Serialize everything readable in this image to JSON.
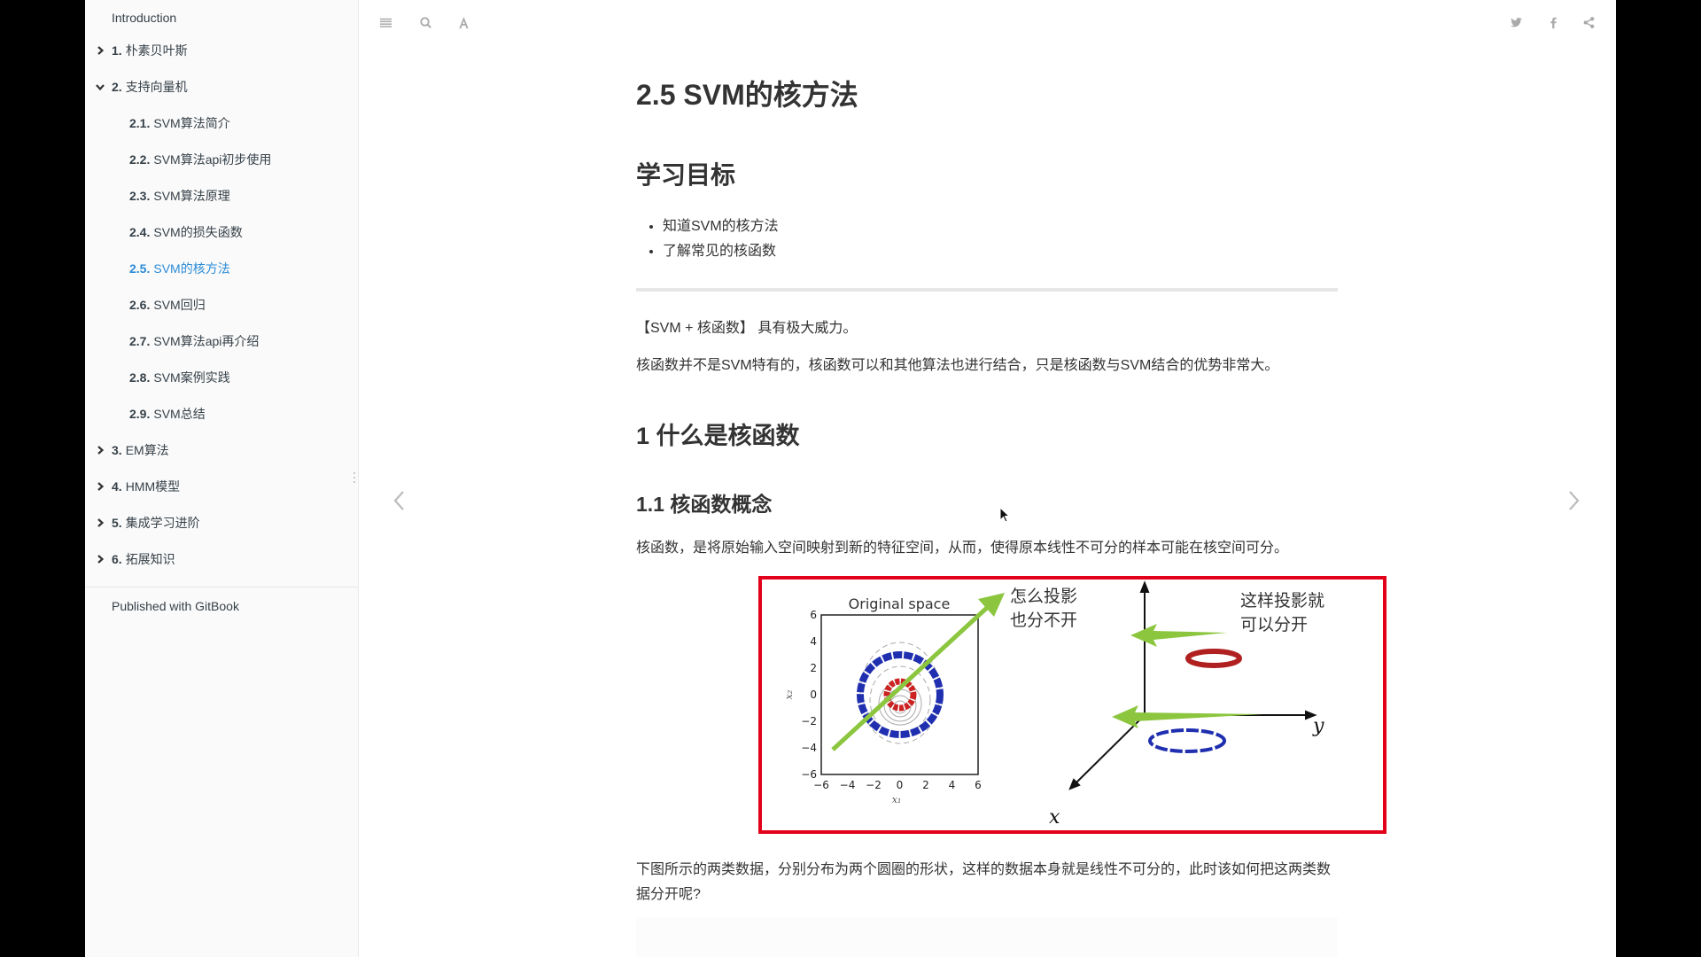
{
  "sidebar": {
    "items": [
      {
        "num": "",
        "label": "Introduction",
        "level": 0,
        "chevron": "none",
        "active": false
      },
      {
        "num": "1.",
        "label": "朴素贝叶斯",
        "level": 1,
        "chevron": "right",
        "active": false
      },
      {
        "num": "2.",
        "label": "支持向量机",
        "level": 1,
        "chevron": "down",
        "active": false
      },
      {
        "num": "2.1.",
        "label": "SVM算法简介",
        "level": 2,
        "chevron": "none",
        "active": false
      },
      {
        "num": "2.2.",
        "label": "SVM算法api初步使用",
        "level": 2,
        "chevron": "none",
        "active": false
      },
      {
        "num": "2.3.",
        "label": "SVM算法原理",
        "level": 2,
        "chevron": "none",
        "active": false
      },
      {
        "num": "2.4.",
        "label": "SVM的损失函数",
        "level": 2,
        "chevron": "none",
        "active": false
      },
      {
        "num": "2.5.",
        "label": "SVM的核方法",
        "level": 2,
        "chevron": "none",
        "active": true
      },
      {
        "num": "2.6.",
        "label": "SVM回归",
        "level": 2,
        "chevron": "none",
        "active": false
      },
      {
        "num": "2.7.",
        "label": "SVM算法api再介绍",
        "level": 2,
        "chevron": "none",
        "active": false
      },
      {
        "num": "2.8.",
        "label": "SVM案例实践",
        "level": 2,
        "chevron": "none",
        "active": false
      },
      {
        "num": "2.9.",
        "label": "SVM总结",
        "level": 2,
        "chevron": "none",
        "active": false
      },
      {
        "num": "3.",
        "label": "EM算法",
        "level": 1,
        "chevron": "right",
        "active": false
      },
      {
        "num": "4.",
        "label": "HMM模型",
        "level": 1,
        "chevron": "right",
        "active": false
      },
      {
        "num": "5.",
        "label": "集成学习进阶",
        "level": 1,
        "chevron": "right",
        "active": false
      },
      {
        "num": "6.",
        "label": "拓展知识",
        "level": 1,
        "chevron": "right",
        "active": false
      }
    ],
    "published": "Published with GitBook",
    "active_color": "#2a8bd8"
  },
  "toolbar": {
    "left_icons": [
      "menu-icon",
      "search-icon",
      "font-settings-icon"
    ],
    "right_icons": [
      "twitter-icon",
      "facebook-icon",
      "share-icon"
    ]
  },
  "nav": {
    "prev": "previous-page-icon",
    "next": "next-page-icon"
  },
  "content": {
    "title": "2.5 SVM的核方法",
    "goals_heading": "学习目标",
    "goals": [
      "知道SVM的核方法",
      "了解常见的核函数"
    ],
    "para1": "【SVM + 核函数】 具有极大威力。",
    "para2": "核函数并不是SVM特有的，核函数可以和其他算法也进行结合，只是核函数与SVM结合的优势非常大。",
    "section1": "1 什么是核函数",
    "section1_1": "1.1 核函数概念",
    "para3": "核函数，是将原始输入空间映射到新的特征空间，从而，使得原本线性不可分的样本可能在核空间可分。",
    "para4": "下图所示的两类数据，分别分布为两个圆圈的形状，这样的数据本身就是线性不可分的，此时该如何把这两类数据分开呢?"
  },
  "figure": {
    "border_color": "#e3001b",
    "plot_title": "Original space",
    "xlabel": "x₁",
    "ylabel": "x₂",
    "ticks": [
      "−6",
      "−4",
      "−2",
      "0",
      "2",
      "4",
      "6"
    ],
    "annotation_left": [
      "怎么投影",
      "也分不开"
    ],
    "annotation_right": [
      "这样投影就",
      "可以分开"
    ],
    "axis_y_label": "y",
    "axis_x_label": "x",
    "arrow_color": "#8cc63f",
    "inner_class_color": "#cc2222",
    "outer_class_color": "#1f2fb0"
  }
}
